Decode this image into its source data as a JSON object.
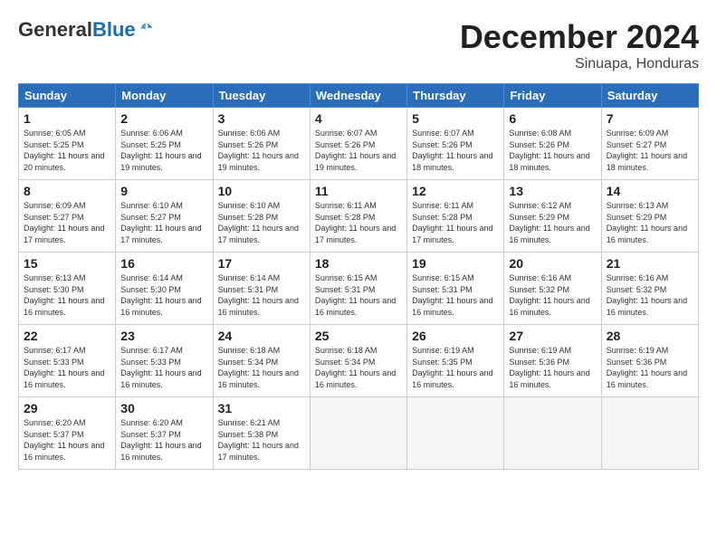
{
  "logo": {
    "general": "General",
    "blue": "Blue"
  },
  "title": "December 2024",
  "location": "Sinuapa, Honduras",
  "days_of_week": [
    "Sunday",
    "Monday",
    "Tuesday",
    "Wednesday",
    "Thursday",
    "Friday",
    "Saturday"
  ],
  "weeks": [
    [
      {
        "day": "1",
        "sunrise": "6:05 AM",
        "sunset": "5:25 PM",
        "daylight": "11 hours and 20 minutes."
      },
      {
        "day": "2",
        "sunrise": "6:06 AM",
        "sunset": "5:25 PM",
        "daylight": "11 hours and 19 minutes."
      },
      {
        "day": "3",
        "sunrise": "6:06 AM",
        "sunset": "5:26 PM",
        "daylight": "11 hours and 19 minutes."
      },
      {
        "day": "4",
        "sunrise": "6:07 AM",
        "sunset": "5:26 PM",
        "daylight": "11 hours and 19 minutes."
      },
      {
        "day": "5",
        "sunrise": "6:07 AM",
        "sunset": "5:26 PM",
        "daylight": "11 hours and 18 minutes."
      },
      {
        "day": "6",
        "sunrise": "6:08 AM",
        "sunset": "5:26 PM",
        "daylight": "11 hours and 18 minutes."
      },
      {
        "day": "7",
        "sunrise": "6:09 AM",
        "sunset": "5:27 PM",
        "daylight": "11 hours and 18 minutes."
      }
    ],
    [
      {
        "day": "8",
        "sunrise": "6:09 AM",
        "sunset": "5:27 PM",
        "daylight": "11 hours and 17 minutes."
      },
      {
        "day": "9",
        "sunrise": "6:10 AM",
        "sunset": "5:27 PM",
        "daylight": "11 hours and 17 minutes."
      },
      {
        "day": "10",
        "sunrise": "6:10 AM",
        "sunset": "5:28 PM",
        "daylight": "11 hours and 17 minutes."
      },
      {
        "day": "11",
        "sunrise": "6:11 AM",
        "sunset": "5:28 PM",
        "daylight": "11 hours and 17 minutes."
      },
      {
        "day": "12",
        "sunrise": "6:11 AM",
        "sunset": "5:28 PM",
        "daylight": "11 hours and 17 minutes."
      },
      {
        "day": "13",
        "sunrise": "6:12 AM",
        "sunset": "5:29 PM",
        "daylight": "11 hours and 16 minutes."
      },
      {
        "day": "14",
        "sunrise": "6:13 AM",
        "sunset": "5:29 PM",
        "daylight": "11 hours and 16 minutes."
      }
    ],
    [
      {
        "day": "15",
        "sunrise": "6:13 AM",
        "sunset": "5:30 PM",
        "daylight": "11 hours and 16 minutes."
      },
      {
        "day": "16",
        "sunrise": "6:14 AM",
        "sunset": "5:30 PM",
        "daylight": "11 hours and 16 minutes."
      },
      {
        "day": "17",
        "sunrise": "6:14 AM",
        "sunset": "5:31 PM",
        "daylight": "11 hours and 16 minutes."
      },
      {
        "day": "18",
        "sunrise": "6:15 AM",
        "sunset": "5:31 PM",
        "daylight": "11 hours and 16 minutes."
      },
      {
        "day": "19",
        "sunrise": "6:15 AM",
        "sunset": "5:31 PM",
        "daylight": "11 hours and 16 minutes."
      },
      {
        "day": "20",
        "sunrise": "6:16 AM",
        "sunset": "5:32 PM",
        "daylight": "11 hours and 16 minutes."
      },
      {
        "day": "21",
        "sunrise": "6:16 AM",
        "sunset": "5:32 PM",
        "daylight": "11 hours and 16 minutes."
      }
    ],
    [
      {
        "day": "22",
        "sunrise": "6:17 AM",
        "sunset": "5:33 PM",
        "daylight": "11 hours and 16 minutes."
      },
      {
        "day": "23",
        "sunrise": "6:17 AM",
        "sunset": "5:33 PM",
        "daylight": "11 hours and 16 minutes."
      },
      {
        "day": "24",
        "sunrise": "6:18 AM",
        "sunset": "5:34 PM",
        "daylight": "11 hours and 16 minutes."
      },
      {
        "day": "25",
        "sunrise": "6:18 AM",
        "sunset": "5:34 PM",
        "daylight": "11 hours and 16 minutes."
      },
      {
        "day": "26",
        "sunrise": "6:19 AM",
        "sunset": "5:35 PM",
        "daylight": "11 hours and 16 minutes."
      },
      {
        "day": "27",
        "sunrise": "6:19 AM",
        "sunset": "5:36 PM",
        "daylight": "11 hours and 16 minutes."
      },
      {
        "day": "28",
        "sunrise": "6:19 AM",
        "sunset": "5:36 PM",
        "daylight": "11 hours and 16 minutes."
      }
    ],
    [
      {
        "day": "29",
        "sunrise": "6:20 AM",
        "sunset": "5:37 PM",
        "daylight": "11 hours and 16 minutes."
      },
      {
        "day": "30",
        "sunrise": "6:20 AM",
        "sunset": "5:37 PM",
        "daylight": "11 hours and 16 minutes."
      },
      {
        "day": "31",
        "sunrise": "6:21 AM",
        "sunset": "5:38 PM",
        "daylight": "11 hours and 17 minutes."
      },
      null,
      null,
      null,
      null
    ]
  ]
}
